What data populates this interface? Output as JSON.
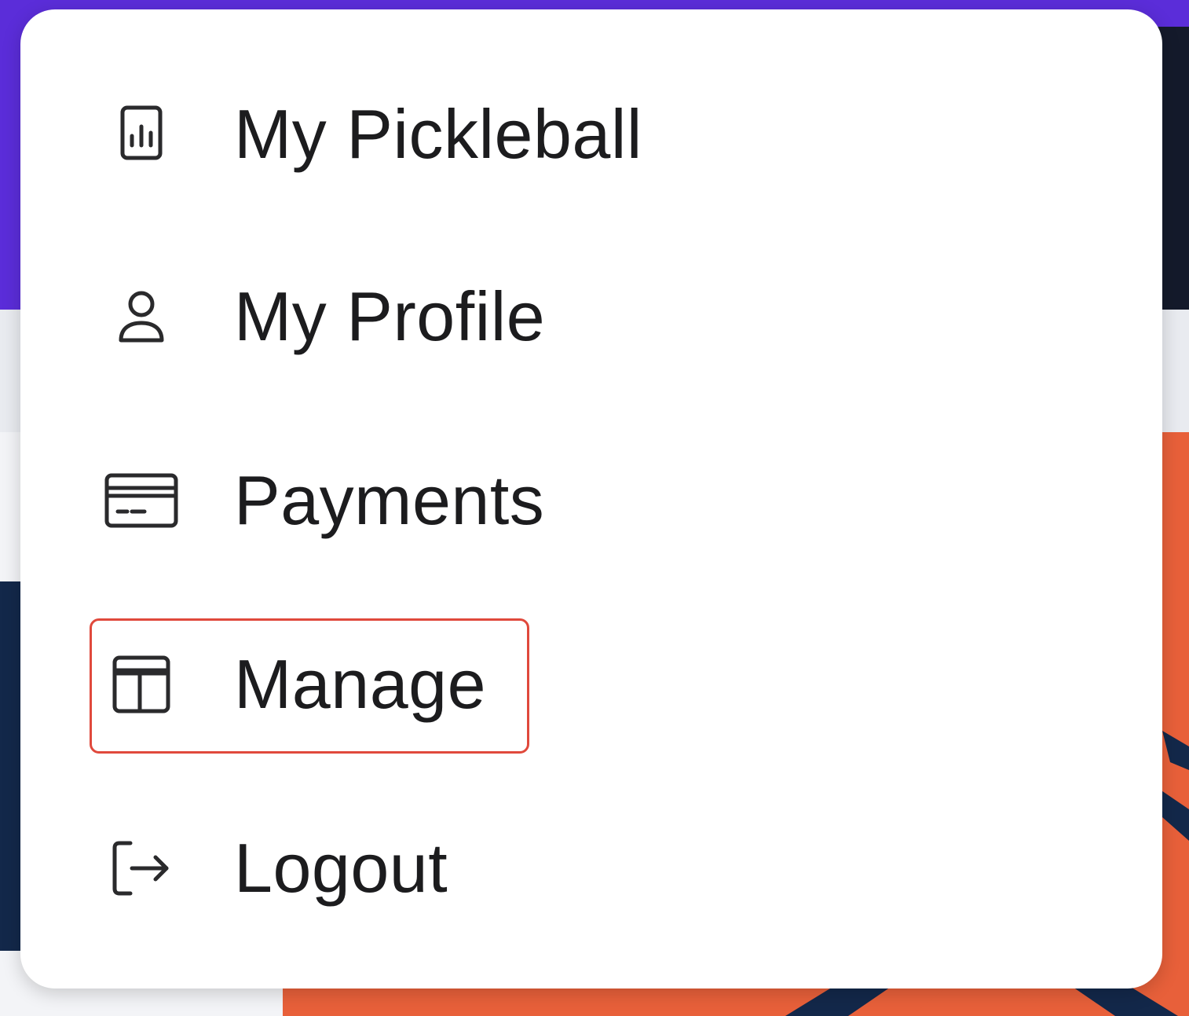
{
  "menu": {
    "items": [
      {
        "label": "My Pickleball",
        "icon": "bar-chart-icon"
      },
      {
        "label": "My Profile",
        "icon": "user-icon"
      },
      {
        "label": "Payments",
        "icon": "credit-card-icon"
      },
      {
        "label": "Manage",
        "icon": "layout-icon",
        "highlighted": true
      },
      {
        "label": "Logout",
        "icon": "logout-icon"
      }
    ]
  },
  "colors": {
    "accent_purple": "#5b2dd9",
    "header_navy": "#141a2b",
    "banner_orange": "#e8603a",
    "highlight_red": "#e0493c",
    "text": "#1c1c1e"
  }
}
